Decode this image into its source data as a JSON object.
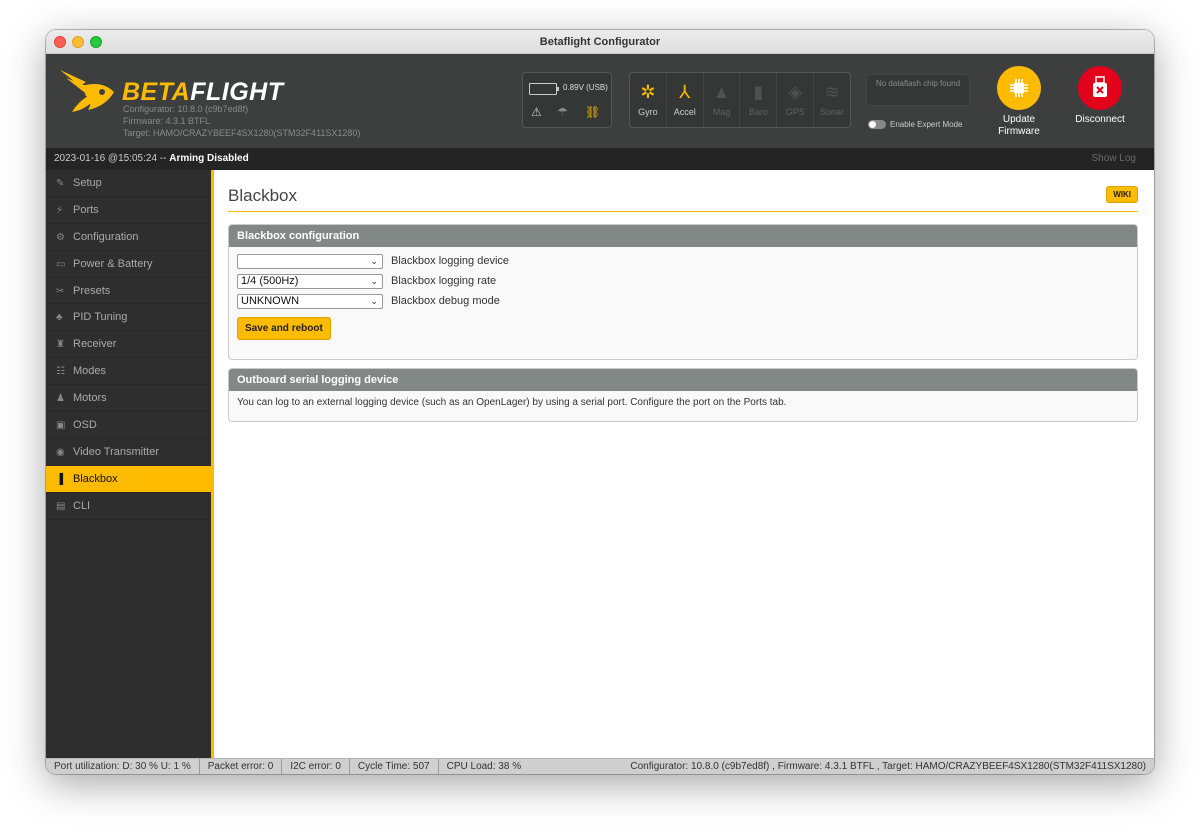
{
  "window": {
    "title": "Betaflight Configurator"
  },
  "header": {
    "brand_part1": "BETA",
    "brand_part2": "FLIGHT",
    "configurator": "Configurator: 10.8.0 (c9b7ed8f)",
    "firmware": "Firmware: 4.3.1 BTFL",
    "target": "Target: HAMO/CRAZYBEEF4SX1280(STM32F411SX1280)",
    "battery": "0.89V (USB)",
    "battery_icons": [
      "warning-icon",
      "parachute-icon",
      "link-icon"
    ],
    "sensors": [
      {
        "label": "Gyro",
        "icon": "gyro-icon",
        "active": true
      },
      {
        "label": "Accel",
        "icon": "accel-icon",
        "active": true
      },
      {
        "label": "Mag",
        "icon": "mag-icon",
        "active": false
      },
      {
        "label": "Baro",
        "icon": "baro-icon",
        "active": false
      },
      {
        "label": "GPS",
        "icon": "gps-icon",
        "active": false
      },
      {
        "label": "Sonar",
        "icon": "sonar-icon",
        "active": false
      }
    ],
    "dataflash": "No dataflash chip found",
    "expert_mode": "Enable Expert Mode",
    "update_firmware_line1": "Update",
    "update_firmware_line2": "Firmware",
    "disconnect": "Disconnect"
  },
  "statusbar": {
    "timestamp": "2023-01-16 @15:05:24 --",
    "arming": "Arming Disabled",
    "show_log": "Show Log"
  },
  "sidebar": {
    "items": [
      {
        "label": "Setup",
        "icon": "wrench-icon",
        "glyph": "✎"
      },
      {
        "label": "Ports",
        "icon": "plug-icon",
        "glyph": "⚡"
      },
      {
        "label": "Configuration",
        "icon": "gear-icon",
        "glyph": "⚙"
      },
      {
        "label": "Power & Battery",
        "icon": "battery-icon",
        "glyph": "▭"
      },
      {
        "label": "Presets",
        "icon": "presets-icon",
        "glyph": "✂"
      },
      {
        "label": "PID Tuning",
        "icon": "pid-icon",
        "glyph": "♣"
      },
      {
        "label": "Receiver",
        "icon": "receiver-icon",
        "glyph": "♜"
      },
      {
        "label": "Modes",
        "icon": "modes-icon",
        "glyph": "☷"
      },
      {
        "label": "Motors",
        "icon": "motors-icon",
        "glyph": "♟"
      },
      {
        "label": "OSD",
        "icon": "osd-icon",
        "glyph": "▣"
      },
      {
        "label": "Video Transmitter",
        "icon": "vtx-icon",
        "glyph": "◉"
      },
      {
        "label": "Blackbox",
        "icon": "blackbox-icon",
        "glyph": "▐",
        "active": true
      },
      {
        "label": "CLI",
        "icon": "cli-icon",
        "glyph": "▤"
      }
    ]
  },
  "main": {
    "title": "Blackbox",
    "wiki": "WIKI",
    "config": {
      "header": "Blackbox configuration",
      "device_value": "",
      "device_label": "Blackbox logging device",
      "rate_value": "1/4 (500Hz)",
      "rate_label": "Blackbox logging rate",
      "debug_value": "UNKNOWN",
      "debug_label": "Blackbox debug mode",
      "save_button": "Save and reboot"
    },
    "outboard": {
      "header": "Outboard serial logging device",
      "text": "You can log to an external logging device (such as an OpenLager) by using a serial port. Configure the port on the Ports tab."
    }
  },
  "footer": {
    "port_util": "Port utilization: D: 30 % U: 1 %",
    "packet_error": "Packet error: 0",
    "i2c_error": "I2C error: 0",
    "cycle_time": "Cycle Time: 507",
    "cpu_load": "CPU Load: 38 %",
    "version": "Configurator: 10.8.0 (c9b7ed8f) , Firmware: 4.3.1 BTFL , Target: HAMO/CRAZYBEEF4SX1280(STM32F411SX1280)"
  },
  "colors": {
    "accent": "#ffbb00",
    "header_bg": "#3d3f3e",
    "sidebar_bg": "#2e2e2e",
    "disconnect": "#e2001a"
  }
}
